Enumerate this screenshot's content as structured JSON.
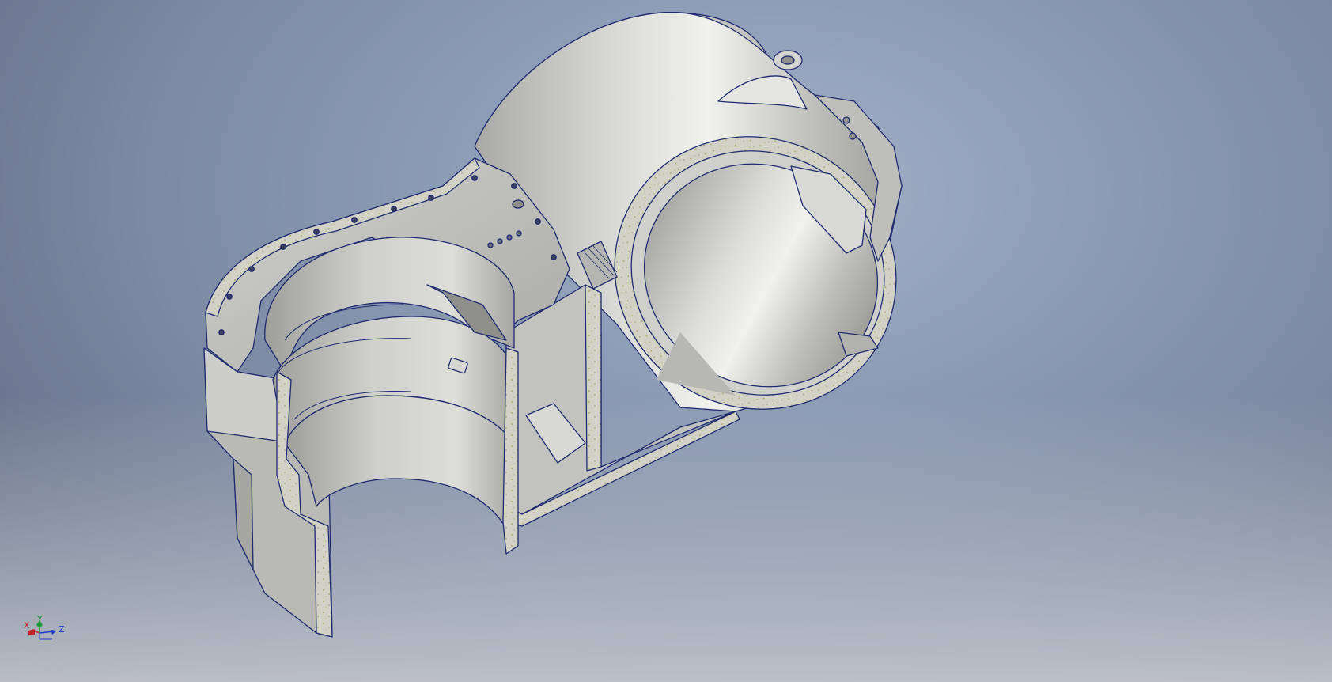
{
  "view": {
    "background_top": "#8d9cb6",
    "background_bottom": "#c8ccd3",
    "model_color": "#c9c9c5",
    "edge_color": "#1e2a6e",
    "section_fill": "#d6d4c8"
  },
  "triad": {
    "x_label": "X",
    "y_label": "Y",
    "z_label": "Z",
    "x_color": "#c0242a",
    "y_color": "#1f9a36",
    "z_color": "#1e3cc8"
  }
}
